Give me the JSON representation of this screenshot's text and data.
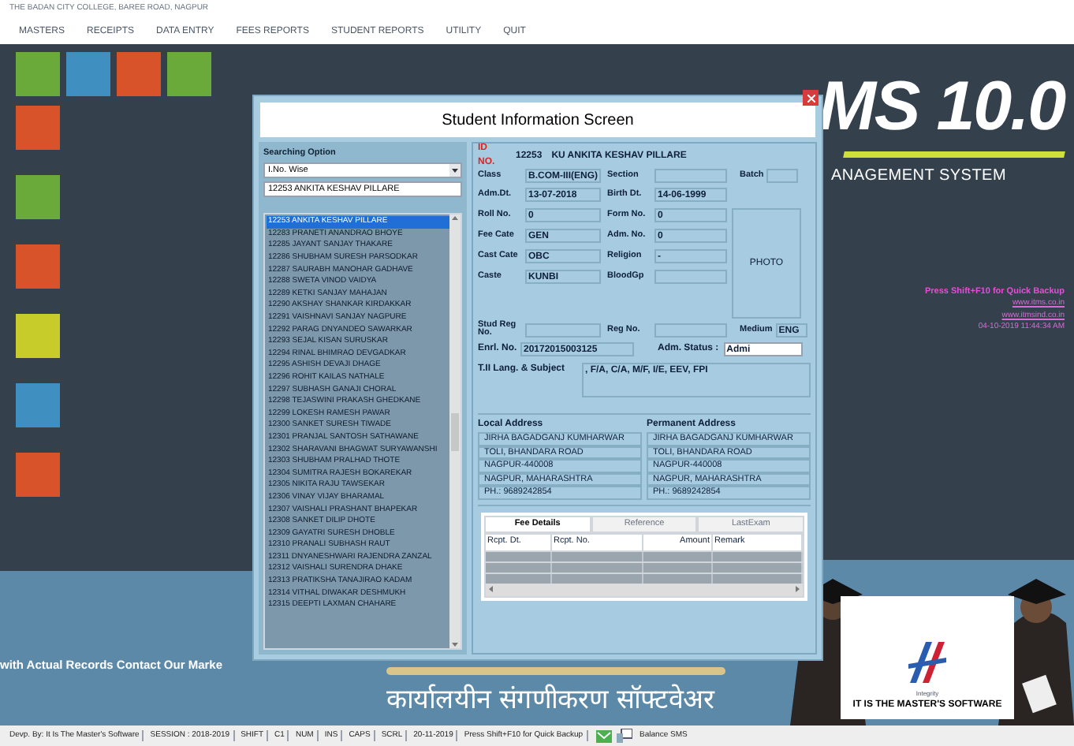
{
  "header": {
    "college": "THE BADAN CITY COLLEGE, BAREE ROAD, NAGPUR"
  },
  "menu": [
    "MASTERS",
    "RECEIPTS",
    "DATA ENTRY",
    "FEES REPORTS",
    "STUDENT REPORTS",
    "UTILITY",
    "QUIT"
  ],
  "tiles": [
    {
      "color": "#6aaa3a"
    },
    {
      "color": "#3f8fc0"
    },
    {
      "color": "#d9532a"
    },
    {
      "color": "#6aaa3a"
    },
    {
      "color": "#d9532a"
    },
    {
      "color": "#6aaa3a"
    },
    {
      "color": "#d9532a"
    },
    {
      "color": "#c8cc2a"
    },
    {
      "color": "#3f8fc0"
    },
    {
      "color": "#d9532a"
    }
  ],
  "brand": {
    "title": "MS 10.0",
    "subtitle": "ANAGEMENT SYSTEM",
    "backup_hint": "Press Shift+F10 for Quick Backup",
    "links": [
      "www.itms.co.in",
      "www.itmsind.co.in"
    ],
    "datetime": "04-10-2019 11:44:34 AM"
  },
  "banner": {
    "contact": "with Actual Records Contact Our Marke",
    "tagline": "कार्यालयीन संगणीकरण सॉफ्टवेअर",
    "logo_caption": "Integrity",
    "logo_text": "IT IS THE MASTER'S SOFTWARE"
  },
  "dialog": {
    "title": "Student Information Screen",
    "search": {
      "label": "Searching Option",
      "option": "I.No. Wise",
      "value": "12253 ANKITA KESHAV PILLARE",
      "items": [
        {
          "text": "12253 ANKITA KESHAV PILLARE",
          "selected": true
        },
        {
          "text": "12283 PRANETI ANANDRAO BHOYE",
          "selected": false
        },
        {
          "text": "12285 JAYANT SANJAY THAKARE",
          "selected": false
        },
        {
          "text": "12286 SHUBHAM SURESH PARSODKAR",
          "selected": false
        },
        {
          "text": "12287 SAURABH MANOHAR GADHAVE",
          "selected": false
        },
        {
          "text": "12288 SWETA VINOD VAIDYA",
          "selected": false
        },
        {
          "text": "12289 KETKI SANJAY MAHAJAN",
          "selected": false
        },
        {
          "text": "12290 AKSHAY SHANKAR KIRDAKKAR",
          "selected": false
        },
        {
          "text": "12291 VAISHNAVI SANJAY NAGPURE",
          "selected": false
        },
        {
          "text": "12292 PARAG DNYANDEO SAWARKAR",
          "selected": false
        },
        {
          "text": "12293 SEJAL KISAN SURUSKAR",
          "selected": false
        },
        {
          "text": "12294 RINAL BHIMRAO DEVGADKAR",
          "selected": false
        },
        {
          "text": "12295 ASHISH DEVAJI DHAGE",
          "selected": false
        },
        {
          "text": "12296 ROHIT KAILAS NATHALE",
          "selected": false
        },
        {
          "text": "12297 SUBHASH GANAJI CHORAL",
          "selected": false
        },
        {
          "text": "12298 TEJASWINI PRAKASH GHEDKANE",
          "selected": false
        },
        {
          "text": "12299 LOKESH RAMESH PAWAR",
          "selected": false
        },
        {
          "text": "12300 SANKET SURESH TIWADE",
          "selected": false
        },
        {
          "text": "12301 PRANJAL SANTOSH SATHAWANE",
          "selected": false
        },
        {
          "text": "12302 SHARAVANI BHAGWAT SURYAWANSHI",
          "selected": false
        },
        {
          "text": "12303 SHUBHAM PRALHAD THOTE",
          "selected": false
        },
        {
          "text": "12304 SUMITRA RAJESH BOKAREKAR",
          "selected": false
        },
        {
          "text": "12305 NIKITA RAJU TAWSEKAR",
          "selected": false
        },
        {
          "text": "12306 VINAY VIJAY BHARAMAL",
          "selected": false
        },
        {
          "text": "12307 VAISHALI PRASHANT BHAPEKAR",
          "selected": false
        },
        {
          "text": "12308 SANKET DILIP DHOTE",
          "selected": false
        },
        {
          "text": "12309 GAYATRI SURESH DHOBLE",
          "selected": false
        },
        {
          "text": "12310 PRANALI SUBHASH RAUT",
          "selected": false
        },
        {
          "text": "12311 DNYANESHWARI RAJENDRA ZANZAL",
          "selected": false
        },
        {
          "text": "12312 VAISHALI SURENDRA DHAKE",
          "selected": false
        },
        {
          "text": "12313 PRATIKSHA TANAJIRAO KADAM",
          "selected": false
        },
        {
          "text": "12314 VITHAL DIWAKAR DESHMUKH",
          "selected": false
        },
        {
          "text": "12315 DEEPTI LAXMAN CHAHARE",
          "selected": false
        }
      ]
    },
    "id": {
      "label": "ID NO.",
      "number": "12253",
      "name": "KU ANKITA KESHAV PILLARE"
    },
    "fields": [
      {
        "label": "Class",
        "value": "B.COM-III(ENG)",
        "label2": "Section",
        "label3": "Batch"
      },
      {
        "label": "Adm.Dt.",
        "value": "13-07-2018",
        "label2": "Birth Dt.",
        "value2": "14-06-1999"
      },
      {
        "label": "Roll No.",
        "value": "0",
        "label2": "Form No.",
        "value2": "0"
      },
      {
        "label": "Fee Cate",
        "value": "GEN",
        "label2": "Adm. No.",
        "value2": "0"
      },
      {
        "label": "Cast Cate",
        "value": "OBC",
        "label2": "Religion",
        "value2": "-"
      },
      {
        "label": "Caste",
        "value": "KUNBI",
        "label2": "BloodGp"
      },
      {
        "label": "Stud Reg No.",
        "label2": "Reg No.",
        "label3": "Medium",
        "value3": "ENG"
      }
    ],
    "photo": "PHOTO",
    "enrollment": {
      "label": "Enrl. No.",
      "value": "20172015003125",
      "status_label": "Adm. Status :",
      "status": "Admi"
    },
    "subjects": {
      "label": "T.II Lang. & Subject",
      "value": ", F/A, C/A, M/F, I/E, EEV, FPI"
    },
    "local_address": {
      "label": "Local Address",
      "lines": [
        "JIRHA BAGADGANJ KUMHARWAR",
        "TOLI, BHANDARA ROAD",
        "NAGPUR-440008",
        "NAGPUR, MAHARASHTRA",
        "PH.: 9689242854"
      ]
    },
    "permanent_address": {
      "label": "Permanent Address",
      "lines": [
        "JIRHA BAGADGANJ KUMHARWAR",
        "TOLI, BHANDARA ROAD",
        "NAGPUR-440008",
        "NAGPUR, MAHARASHTRA",
        "PH.: 9689242854"
      ]
    },
    "tabs": [
      {
        "label": "Fee Details",
        "selected": true
      },
      {
        "label": "Reference",
        "selected": false
      },
      {
        "label": "LastExam",
        "selected": false
      }
    ],
    "table": {
      "columns": [
        "Rcpt. Dt.",
        "Rcpt. No.",
        "Amount",
        "Remark"
      ]
    }
  },
  "status_bar": {
    "items": [
      "Devp. By: It Is The Master's Software",
      "SESSION : 2018-2019",
      "SHIFT",
      "C1",
      "NUM",
      "INS",
      "CAPS",
      "SCRL",
      "20-11-2019",
      "Press Shift+F10 for Quick Backup"
    ],
    "sms": "Balance SMS"
  }
}
